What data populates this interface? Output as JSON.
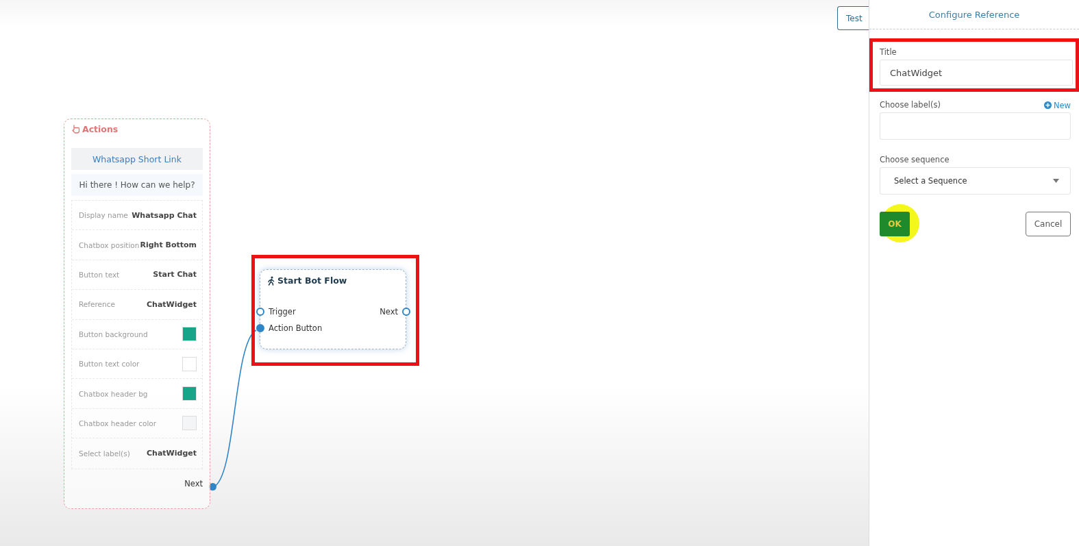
{
  "toolbar": {
    "test_button": "Test"
  },
  "actions_node": {
    "title": "Actions",
    "header": "Whatsapp Short Link",
    "greeting": "Hi there ! How can we help?",
    "rows": [
      {
        "kind": "text",
        "label": "Display name",
        "value": "Whatsapp Chat"
      },
      {
        "kind": "text",
        "label": "Chatbox position",
        "value": "Right Bottom"
      },
      {
        "kind": "text",
        "label": "Button text",
        "value": "Start Chat"
      },
      {
        "kind": "text",
        "label": "Reference",
        "value": "ChatWidget"
      },
      {
        "kind": "color",
        "label": "Button background",
        "color": "#17a589"
      },
      {
        "kind": "color",
        "label": "Button text color",
        "color": "#ffffff"
      },
      {
        "kind": "color",
        "label": "Chatbox header bg",
        "color": "#17a589"
      },
      {
        "kind": "color",
        "label": "Chatbox header color",
        "color": "#f4f5f6"
      },
      {
        "kind": "text",
        "label": "Select label(s)",
        "value": "ChatWidget"
      }
    ],
    "output": "Next"
  },
  "start_node": {
    "title": "Start Bot Flow",
    "highlighted": true,
    "inputs": [
      {
        "label": "Trigger",
        "connected": false
      },
      {
        "label": "Action Button",
        "connected": true
      }
    ],
    "output": {
      "label": "Next",
      "connected": false
    }
  },
  "panel": {
    "title": "Configure Reference",
    "title_field": {
      "label": "Title",
      "value": "ChatWidget",
      "highlighted": true
    },
    "labels_field": {
      "label": "Choose label(s)",
      "new_link": "New"
    },
    "sequence_field": {
      "label": "Choose sequence",
      "placeholder": "Select a Sequence"
    },
    "ok_button": "OK",
    "cancel_button": "Cancel"
  }
}
